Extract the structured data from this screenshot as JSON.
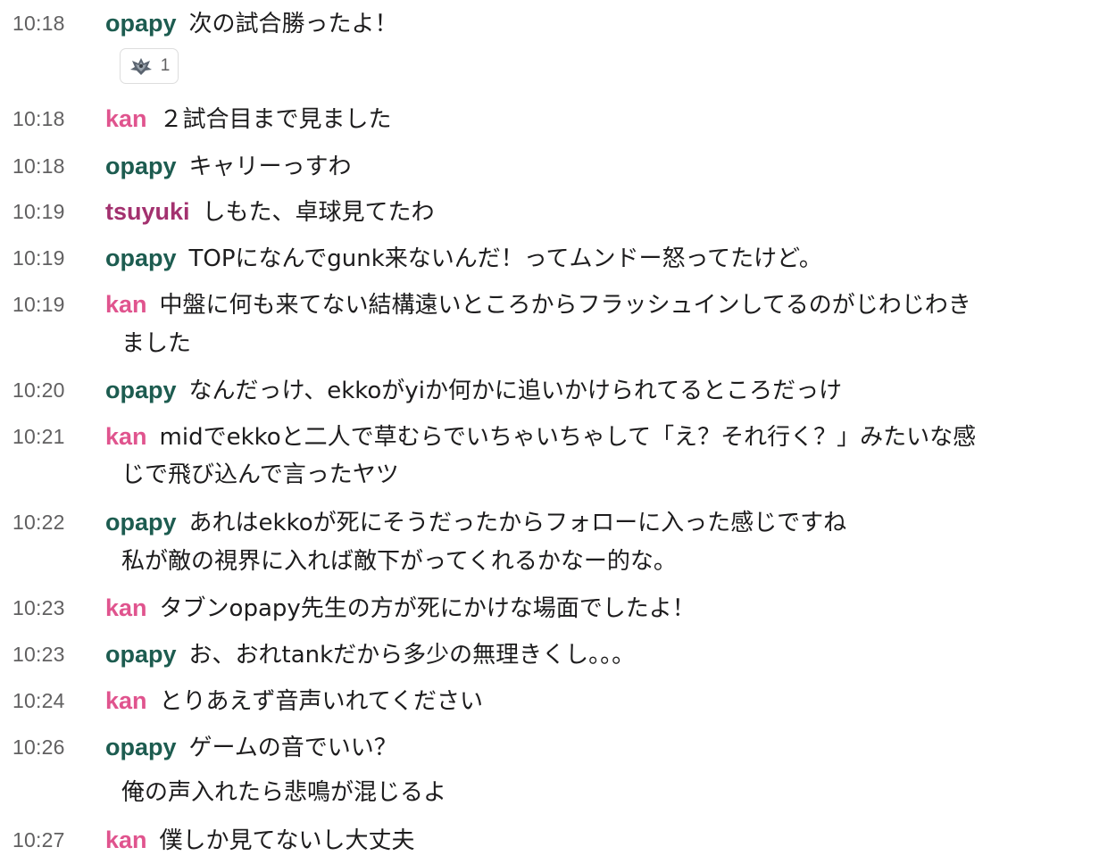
{
  "messages": [
    {
      "time": "10:18",
      "user": "opapy",
      "lines": [
        "次の試合勝ったよ！"
      ],
      "reaction": {
        "icon": "team-crest-emoji-icon",
        "count": "1"
      }
    },
    {
      "time": "10:18",
      "user": "kan",
      "lines": [
        "２試合目まで見ました"
      ]
    },
    {
      "time": "10:18",
      "user": "opapy",
      "lines": [
        "キャリーっすわ"
      ]
    },
    {
      "time": "10:19",
      "user": "tsuyuki",
      "lines": [
        "しもた、卓球見てたわ"
      ]
    },
    {
      "time": "10:19",
      "user": "opapy",
      "lines": [
        "TOPになんでgunk来ないんだ！ってムンドー怒ってたけど。"
      ]
    },
    {
      "time": "10:19",
      "user": "kan",
      "lines": [
        "中盤に何も来てない結構遠いところからフラッシュインしてるのがじわじわき",
        "ました"
      ]
    },
    {
      "time": "10:20",
      "user": "opapy",
      "lines": [
        "なんだっけ、ekkoがyiか何かに追いかけられてるところだっけ"
      ]
    },
    {
      "time": "10:21",
      "user": "kan",
      "lines": [
        "midでekkoと二人で草むらでいちゃいちゃして「え？それ行く？」みたいな感",
        "じで飛び込んで言ったヤツ"
      ]
    },
    {
      "time": "10:22",
      "user": "opapy",
      "lines": [
        "あれはekkoが死にそうだったからフォローに入った感じですね",
        "私が敵の視界に入れば敵下がってくれるかなー的な。"
      ]
    },
    {
      "time": "10:23",
      "user": "kan",
      "lines": [
        "タブンopapy先生の方が死にかけな場面でしたよ！"
      ]
    },
    {
      "time": "10:23",
      "user": "opapy",
      "lines": [
        "お、おれtankだから多少の無理きくし。。。"
      ]
    },
    {
      "time": "10:24",
      "user": "kan",
      "lines": [
        "とりあえず音声いれてください"
      ]
    },
    {
      "time": "10:26",
      "user": "opapy",
      "lines": [
        "ゲームの音でいい？",
        "俺の声入れたら悲鳴が混じるよ"
      ]
    },
    {
      "time": "10:27",
      "user": "kan",
      "lines": [
        "僕しか見てないし大丈夫"
      ]
    }
  ],
  "colors": {
    "opapy": "#1d5c50",
    "kan": "#e0548e",
    "tsuyuki": "#a3316f",
    "timestamp": "#616061",
    "text": "#1d1c1d"
  }
}
